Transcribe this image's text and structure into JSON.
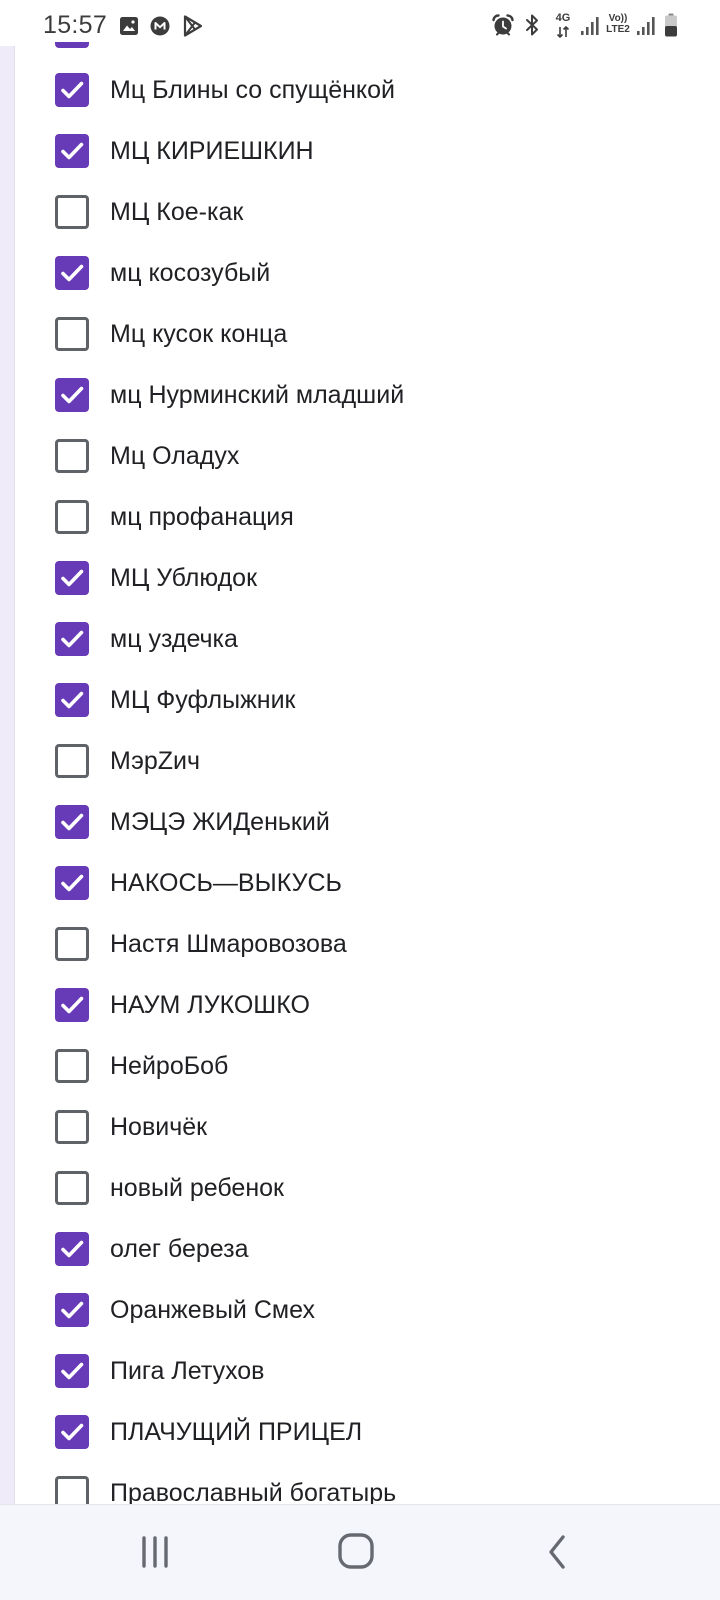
{
  "status_bar": {
    "time": "15:57",
    "notification_icons": [
      "gallery-icon",
      "m-logo-icon",
      "play-store-icon"
    ],
    "system_icons": [
      "alarm-icon",
      "bluetooth-icon",
      "mobile-data-icon",
      "signal-icon",
      "volte-icon",
      "signal-icon",
      "battery-icon"
    ],
    "network_type": "4G",
    "volte_top": "Vo))",
    "volte_bottom": "LTE2",
    "battery_level": 0.5
  },
  "colors": {
    "accent": "#673ab7",
    "form_background": "#f0ebf8",
    "text": "#202124",
    "unchecked_border": "#5f6368"
  },
  "partial_option_above": {
    "checked": true
  },
  "options": [
    {
      "label": "Мц Блины со спущёнкой",
      "checked": true
    },
    {
      "label": "МЦ КИРИЕШКИН",
      "checked": true
    },
    {
      "label": "МЦ Кое-как",
      "checked": false
    },
    {
      "label": "мц косозубый",
      "checked": true
    },
    {
      "label": "Мц кусок конца",
      "checked": false
    },
    {
      "label": "мц Нурминский младший",
      "checked": true
    },
    {
      "label": "Мц Оладух",
      "checked": false
    },
    {
      "label": "мц профанация",
      "checked": false
    },
    {
      "label": "МЦ Ублюдок",
      "checked": true
    },
    {
      "label": "мц уздечка",
      "checked": true
    },
    {
      "label": "МЦ Фуфлыжник",
      "checked": true
    },
    {
      "label": "МэрZич",
      "checked": false
    },
    {
      "label": "МЭЦЭ ЖИДенький",
      "checked": true
    },
    {
      "label": "НАКОСЬ—ВЫКУСЬ",
      "checked": true
    },
    {
      "label": "Настя Шмаровозова",
      "checked": false
    },
    {
      "label": "НАУМ ЛУКОШКО",
      "checked": true
    },
    {
      "label": "НейроБоб",
      "checked": false
    },
    {
      "label": "Новичёк",
      "checked": false
    },
    {
      "label": "новый ребенок",
      "checked": false
    },
    {
      "label": "олег береза",
      "checked": true
    },
    {
      "label": "Оранжевый Смех",
      "checked": true
    },
    {
      "label": "Пига Летухов",
      "checked": true
    },
    {
      "label": "ПЛАЧУЩИЙ ПРИЦЕЛ",
      "checked": true
    },
    {
      "label": "Православный богатырь",
      "checked": false
    }
  ],
  "nav_bar": {
    "buttons": [
      "recent-apps-icon",
      "home-icon",
      "back-icon"
    ]
  }
}
